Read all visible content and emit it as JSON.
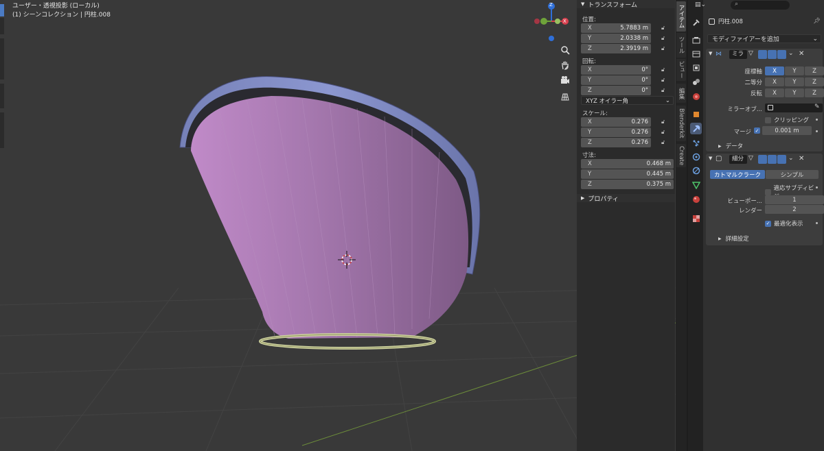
{
  "viewport": {
    "header_line1": "ユーザー・透視投影 (ローカル)",
    "header_line2": "(1) シーンコレクション | 円柱.008",
    "gizmo": {
      "z": "Z",
      "y": "Y",
      "x": "X"
    },
    "nav_icons": [
      "zoom-icon",
      "hand-pan-icon",
      "camera-icon",
      "ortho-grid-icon"
    ]
  },
  "npanel": {
    "transform_title": "トランスフォーム",
    "location_label": "位置:",
    "location": [
      {
        "axis": "X",
        "value": "5.7883 m"
      },
      {
        "axis": "Y",
        "value": "2.0338 m"
      },
      {
        "axis": "Z",
        "value": "2.3919 m"
      }
    ],
    "rotation_label": "回転:",
    "rotation": [
      {
        "axis": "X",
        "value": "0°"
      },
      {
        "axis": "Y",
        "value": "0°"
      },
      {
        "axis": "Z",
        "value": "0°"
      }
    ],
    "rotation_mode": "XYZ オイラー角",
    "scale_label": "スケール:",
    "scale": [
      {
        "axis": "X",
        "value": "0.276"
      },
      {
        "axis": "Y",
        "value": "0.276"
      },
      {
        "axis": "Z",
        "value": "0.276"
      }
    ],
    "dimensions_label": "寸法:",
    "dimensions": [
      {
        "axis": "X",
        "value": "0.468 m"
      },
      {
        "axis": "Y",
        "value": "0.445 m"
      },
      {
        "axis": "Z",
        "value": "0.375 m"
      }
    ],
    "properties_title": "プロパティ"
  },
  "vtabs": [
    "アイテム",
    "ツール",
    "ビュー",
    "編集",
    "Blenderkit",
    "Create"
  ],
  "props": {
    "object_name": "円柱.008",
    "add_modifier": "モディファイアーを追加",
    "mirror": {
      "name": "ミラ",
      "axis_label": "座標軸",
      "bisect_label": "二等分",
      "flip_label": "反転",
      "x": "X",
      "y": "Y",
      "z": "Z",
      "mirror_object_label": "ミラーオブ...",
      "clipping_label": "クリッピング",
      "merge_label": "マージ",
      "merge_value": "0.001 m",
      "data_label": "データ"
    },
    "subsurf": {
      "name": "細分",
      "catmull": "カトマルクラーク",
      "simple": "シンプル",
      "adaptive_label": "適応サブディビジ...",
      "viewport_label": "ビューポー...",
      "viewport_value": "1",
      "render_label": "レンダー",
      "render_value": "2",
      "optimal_label": "最適化表示",
      "advanced_label": "詳細設定"
    }
  }
}
